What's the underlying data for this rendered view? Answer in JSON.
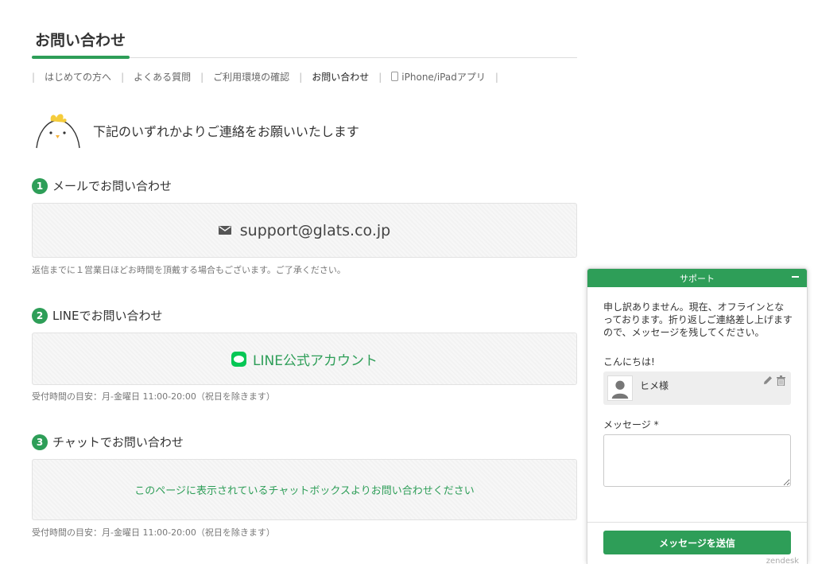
{
  "page": {
    "title": "お問い合わせ",
    "intro": "下記のいずれかよりご連絡をお願いいたします"
  },
  "subnav": {
    "items": [
      "はじめての方へ",
      "よくある質問",
      "ご利用環境の確認",
      "お問い合わせ",
      "iPhone/iPadアプリ"
    ],
    "active_index": 3
  },
  "sections": {
    "mail": {
      "number": "1",
      "heading": "メールでお問い合わせ",
      "value": "support@glats.co.jp",
      "note": "返信までに１営業日ほどお時間を頂戴する場合もございます。ご了承ください。"
    },
    "line": {
      "number": "2",
      "heading": "LINEでお問い合わせ",
      "value": "LINE公式アカウント",
      "note": "受付時間の目安：月-金曜日 11:00-20:00（祝日を除きます）"
    },
    "chat": {
      "number": "3",
      "heading": "チャットでお問い合わせ",
      "value": "このページに表示されているチャットボックスよりお問い合わせください",
      "note": "受付時間の目安：月-金曜日 11:00-20:00（祝日を除きます）"
    }
  },
  "widget": {
    "title": "サポート",
    "offline_message": "申し訳ありません。現在、オフラインとなっております。折り返しご連絡差し上げますので、メッセージを残してください。",
    "greeting": "こんにちは!",
    "user_name": "ヒメ様",
    "message_label": "メッセージ *",
    "message_value": "",
    "send_label": "メッセージを送信",
    "brand": "zendesk"
  },
  "colors": {
    "accent": "#2e9e58",
    "line_green": "#06c755"
  },
  "icons": [
    "chick-mascot-icon",
    "mail-icon",
    "line-icon",
    "phone-icon",
    "user-avatar-icon",
    "pencil-icon",
    "trash-icon",
    "minimize-icon"
  ]
}
